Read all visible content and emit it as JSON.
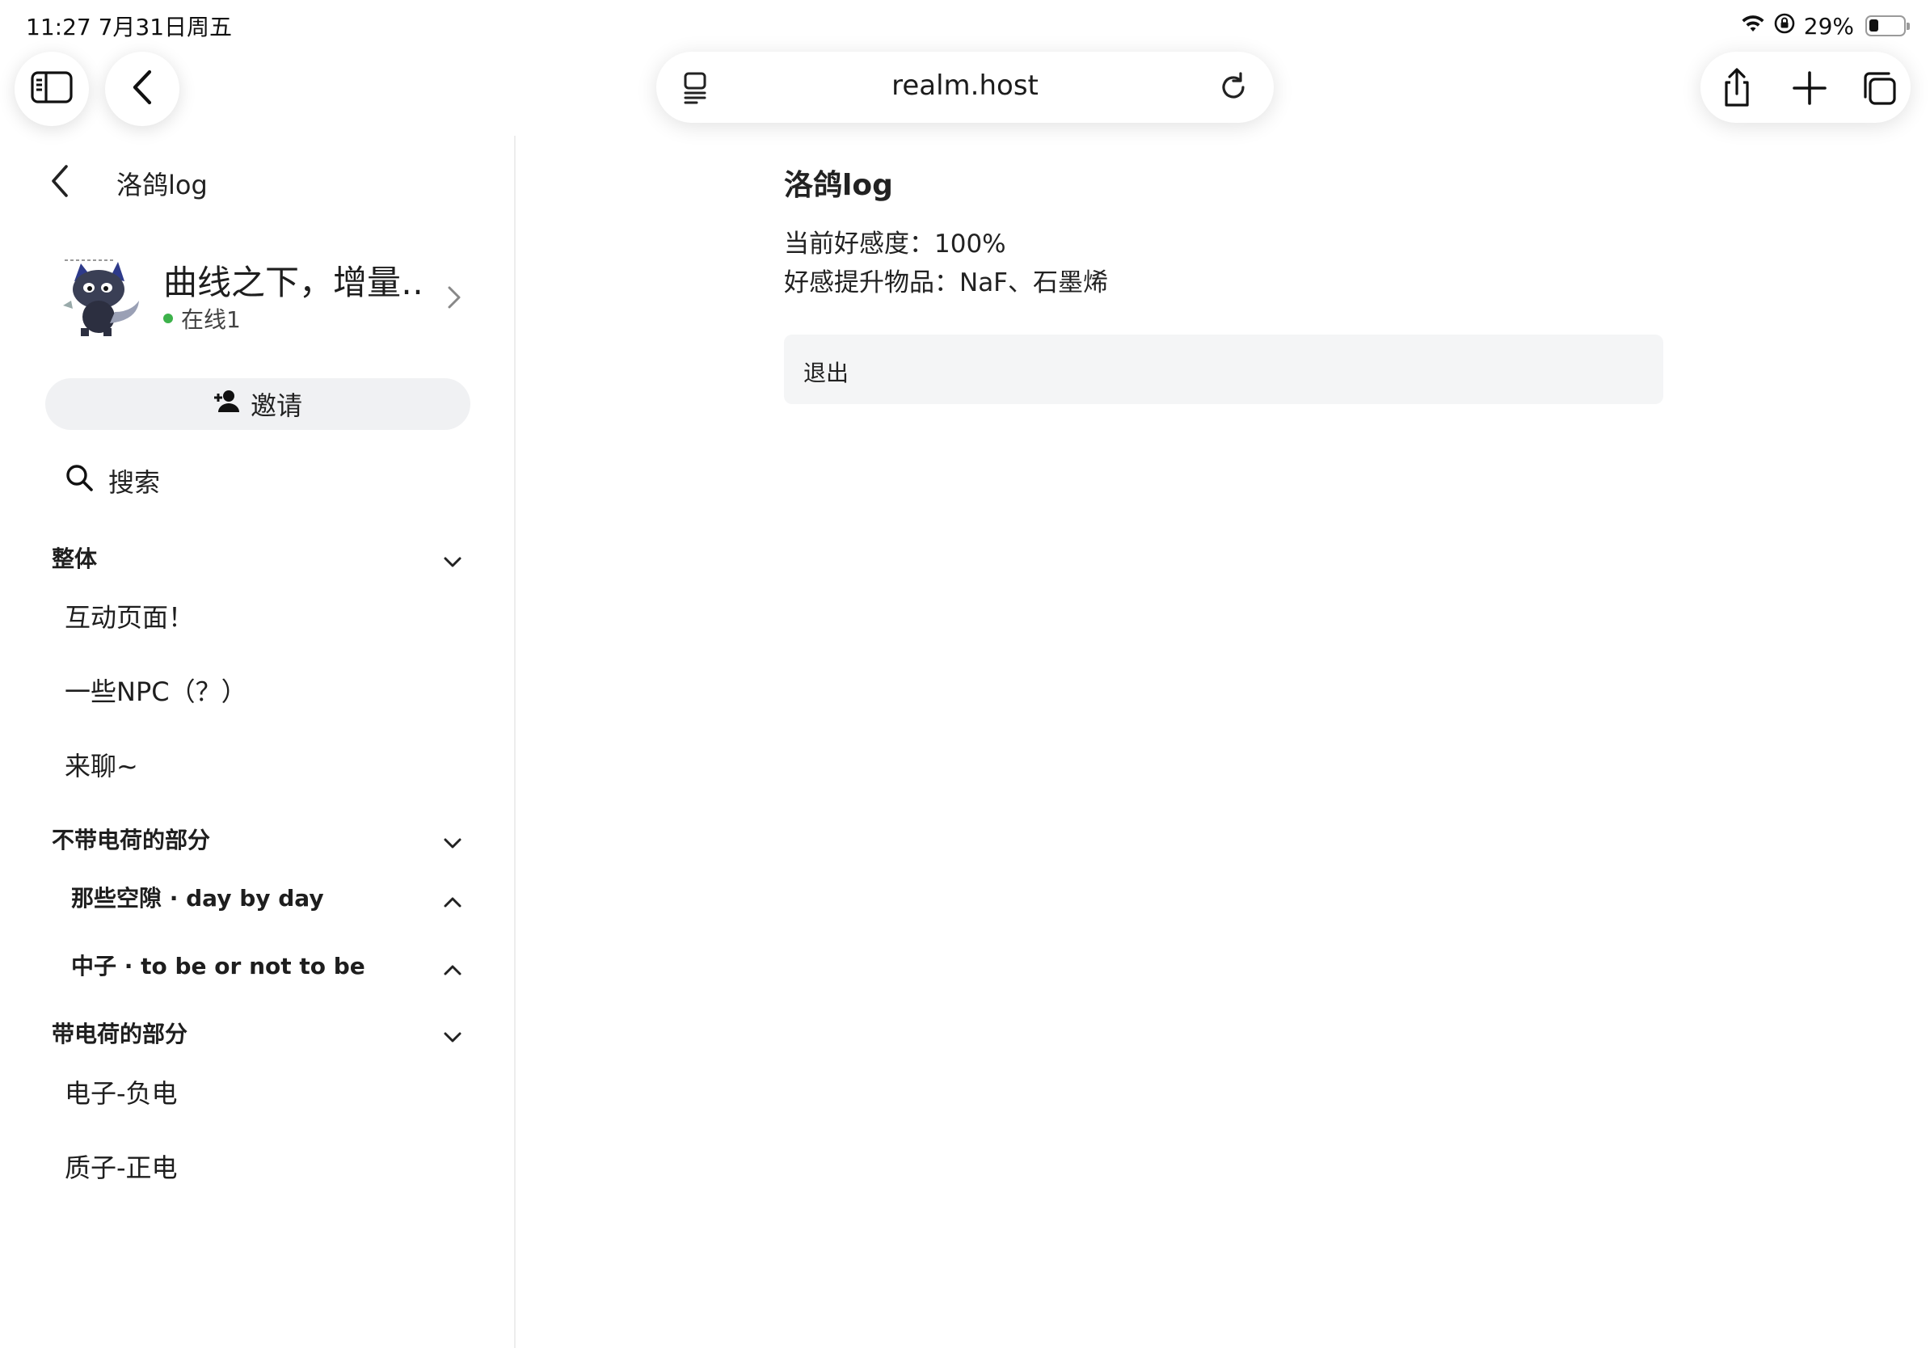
{
  "status_bar": {
    "time_date": "11:27  7月31日周五",
    "battery_percent": "29%",
    "battery_level": 0.29,
    "icons": [
      "wifi-icon",
      "orientation-lock-icon",
      "battery-icon"
    ]
  },
  "browser": {
    "address": "realm.host",
    "icons": [
      "sidebar-toggle-icon",
      "back-icon",
      "page-menu-icon",
      "reload-icon",
      "share-icon",
      "plus-icon",
      "tabs-icon"
    ]
  },
  "sidebar": {
    "back_title": "洛鸽log",
    "server_name": "曲线之下，增量…",
    "online_text": "在线1",
    "online_color": "#3db24b",
    "invite_label": "邀请",
    "search_label": "搜索",
    "sections": {
      "overall": {
        "label": "整体",
        "channels": [
          "互动页面！",
          "一些NPC（？）",
          "来聊~"
        ]
      },
      "uncharged": {
        "label": "不带电荷的部分",
        "subsections": [
          "那些空隙 · day by day",
          "中子 · to be or not to be"
        ]
      },
      "charged": {
        "label": "带电荷的部分",
        "channels": [
          "电子-负电",
          "质子-正电"
        ]
      }
    }
  },
  "main": {
    "title": "洛鸽log",
    "line1": "当前好感度：100%",
    "line2": "好感提升物品：NaF、石墨烯",
    "exit_label": "退出"
  }
}
